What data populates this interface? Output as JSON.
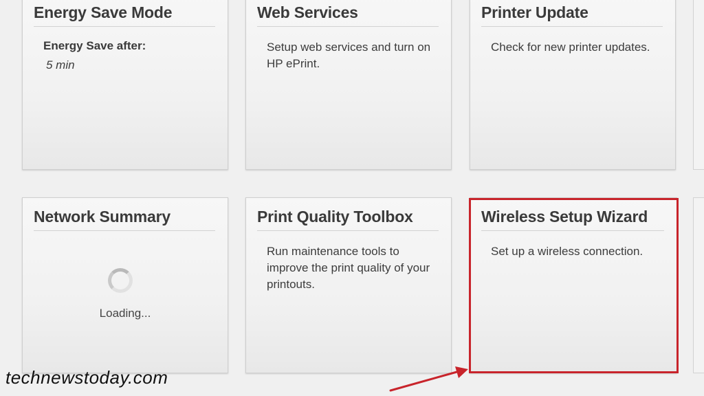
{
  "tiles": {
    "energy_save": {
      "title": "Energy Save Mode",
      "label": "Energy Save after:",
      "value": "5 min"
    },
    "web_services": {
      "title": "Web Services",
      "description": "Setup web services and turn on HP ePrint."
    },
    "printer_update": {
      "title": "Printer Update",
      "description": "Check for new printer updates."
    },
    "network_summary": {
      "title": "Network Summary",
      "status": "Loading..."
    },
    "print_quality": {
      "title": "Print Quality Toolbox",
      "description": "Run maintenance tools to improve the print quality of your printouts."
    },
    "wireless_setup": {
      "title": "Wireless Setup Wizard",
      "description": "Set up a wireless connection."
    }
  },
  "annotation": {
    "highlight_color": "#c8242b"
  },
  "watermark": "technewstoday.com"
}
